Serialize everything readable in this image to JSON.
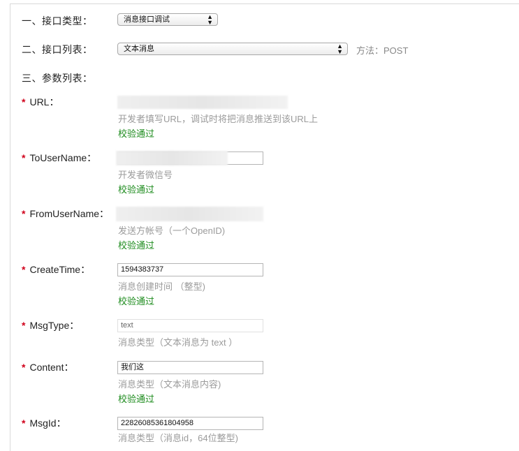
{
  "section1": {
    "label": "一、接口类型：",
    "select_value": "消息接口调试"
  },
  "section2": {
    "label": "二、接口列表：",
    "select_value": "文本消息",
    "method": "方法：POST"
  },
  "section3": {
    "label": "三、参数列表："
  },
  "required_mark": "*",
  "arrows": {
    "up": "▲",
    "down": "▼"
  },
  "params": [
    {
      "label": "URL：",
      "value": "",
      "hint": "开发者填写URL，调试时将把消息推送到该URL上",
      "status": "校验通过"
    },
    {
      "label": "ToUserName：",
      "value": "",
      "hint": "开发者微信号",
      "status": "校验通过"
    },
    {
      "label": "FromUserName：",
      "value": "",
      "hint": "发送方帐号（一个OpenID)",
      "status": "校验通过"
    },
    {
      "label": "CreateTime：",
      "value": "1594383737",
      "hint": "消息创建时间 （整型)",
      "status": "校验通过"
    },
    {
      "label": "MsgType：",
      "value": "text",
      "hint": "消息类型（文本消息为 text ）",
      "status": ""
    },
    {
      "label": "Content：",
      "value": "我们这",
      "hint": "消息类型（文本消息内容)",
      "status": "校验通过"
    },
    {
      "label": "MsgId：",
      "value": "22826085361804958",
      "hint": "消息类型（消息id，64位整型)",
      "status": ""
    }
  ],
  "colors": {
    "required": "#d0021b",
    "success": "#1e8c1e",
    "hint": "#9b9b9b"
  }
}
